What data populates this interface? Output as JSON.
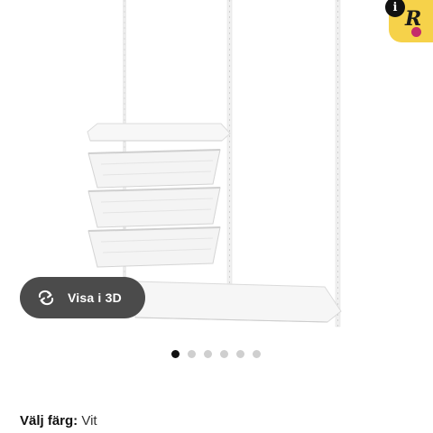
{
  "product_image": {
    "alt": "white shelving with wire baskets"
  },
  "badge": {
    "info_glyph": "i",
    "letter": "R",
    "accent_color": "#f6d24a"
  },
  "view_3d": {
    "label": "Visa i 3D",
    "icon": "rotate-arrows-icon",
    "background": "#4b4b4b"
  },
  "carousel": {
    "total": 6,
    "active_index": 0
  },
  "color_selector": {
    "label": "Välj färg:",
    "value": "Vit"
  }
}
